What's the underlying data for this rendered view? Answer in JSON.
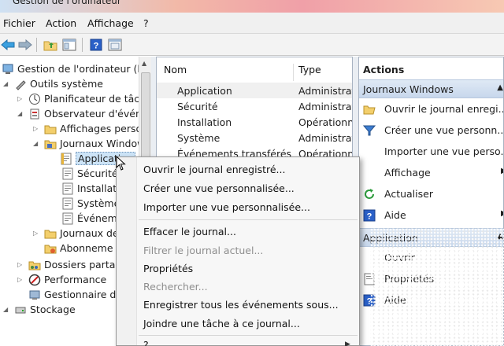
{
  "window": {
    "title": "Gestion de l'ordinateur"
  },
  "menubar": {
    "items": [
      "Fichier",
      "Action",
      "Affichage",
      "?"
    ]
  },
  "toolbar": {
    "buttons": [
      "back-arrow-icon",
      "forward-arrow-icon",
      "up-folder-icon",
      "console-tree-icon",
      "help-icon",
      "properties-icon"
    ]
  },
  "tree": {
    "items": [
      {
        "label": "Gestion de l'ordinateur (loca",
        "icon": "computer-icon"
      },
      {
        "label": "Outils système",
        "icon": "tools-icon"
      },
      {
        "label": "Planificateur de tâch",
        "icon": "clock-icon"
      },
      {
        "label": "Observateur d'événe",
        "icon": "event-viewer-icon"
      },
      {
        "label": "Affichages perso",
        "icon": "folder-icon"
      },
      {
        "label": "Journaux Window",
        "icon": "folder-icon"
      },
      {
        "label": "Application",
        "icon": "log-icon",
        "selected": true
      },
      {
        "label": "Sécurité",
        "icon": "log-icon"
      },
      {
        "label": "Installat",
        "icon": "log-icon"
      },
      {
        "label": "Système",
        "icon": "log-icon"
      },
      {
        "label": "Événem",
        "icon": "log-icon"
      },
      {
        "label": "Journaux de",
        "icon": "folder-icon"
      },
      {
        "label": "Abonneme",
        "icon": "subscription-icon"
      },
      {
        "label": "Dossiers partag",
        "icon": "shared-folder-icon"
      },
      {
        "label": "Performance",
        "icon": "performance-icon"
      },
      {
        "label": "Gestionnaire de",
        "icon": "device-manager-icon"
      },
      {
        "label": "Stockage",
        "icon": "storage-icon"
      }
    ]
  },
  "list": {
    "headers": {
      "name": "Nom",
      "type": "Type"
    },
    "rows": [
      {
        "name": "Application",
        "type": "Administrat"
      },
      {
        "name": "Sécurité",
        "type": "Administrat"
      },
      {
        "name": "Installation",
        "type": "Opérationne"
      },
      {
        "name": "Système",
        "type": "Administrat"
      },
      {
        "name": "Événements transférés",
        "type": "Opérationne"
      }
    ]
  },
  "actions": {
    "header": "Actions",
    "section1": "Journaux Windows",
    "items1": [
      {
        "label": "Ouvrir le journal enregi...",
        "icon": "open-folder-icon"
      },
      {
        "label": "Créer une vue personn...",
        "icon": "filter-icon"
      },
      {
        "label": "Importer une vue perso...",
        "icon": ""
      },
      {
        "label": "Affichage",
        "icon": "",
        "submenu": true
      },
      {
        "label": "Actualiser",
        "icon": "refresh-icon"
      },
      {
        "label": "Aide",
        "icon": "help-icon",
        "submenu": true
      }
    ],
    "section2": "Application",
    "items2": [
      {
        "label": "Ouvrir",
        "icon": ""
      },
      {
        "label": "Propriétés",
        "icon": "properties-icon"
      },
      {
        "label": "Aide",
        "icon": "help-icon"
      }
    ]
  },
  "context_menu": {
    "items": [
      {
        "label": "Ouvrir le journal enregistré...",
        "disabled": false
      },
      {
        "label": "Créer une vue personnalisée...",
        "disabled": false
      },
      {
        "label": "Importer une vue personnalisée...",
        "disabled": false
      },
      {
        "label": "Effacer le journal...",
        "disabled": false
      },
      {
        "label": "Filtrer le journal actuel...",
        "disabled": true
      },
      {
        "label": "Propriétés",
        "disabled": false
      },
      {
        "label": "Rechercher...",
        "disabled": true
      },
      {
        "label": "Enregistrer tous les événements sous...",
        "disabled": false
      },
      {
        "label": "Joindre une tâche à ce journal...",
        "disabled": false
      },
      {
        "label": "?",
        "disabled": false
      }
    ]
  },
  "colors": {
    "selection": "#cde4f7",
    "section_header": "#dfe9f5",
    "accent": "#1f5da8"
  }
}
